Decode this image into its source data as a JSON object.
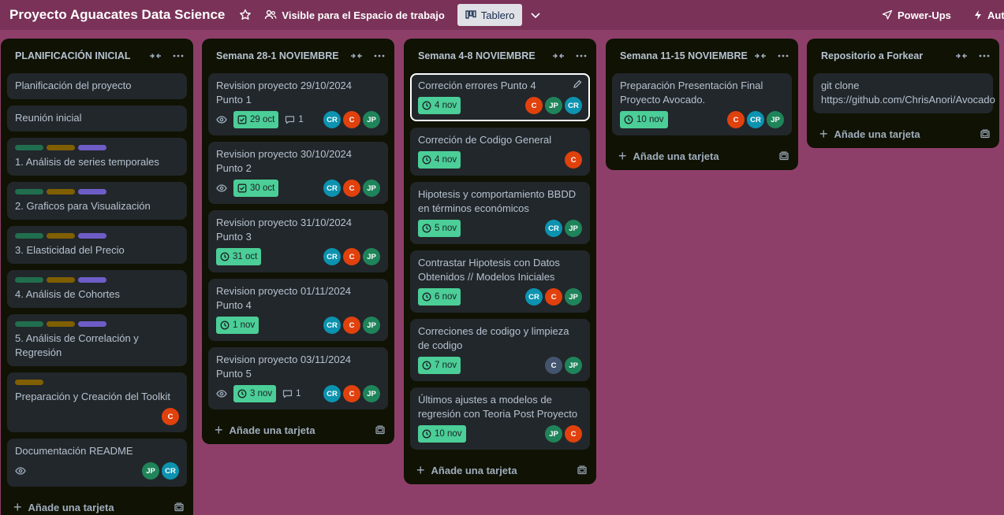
{
  "header": {
    "board_title": "Proyecto Aguacates Data Science",
    "visibility_label": "Visible para el Espacio de trabajo",
    "view_label": "Tablero",
    "powerups_label": "Power-Ups",
    "automation_label": "Aut"
  },
  "colors": {
    "background": "#8e3f69",
    "list_bg": "#101204",
    "card_bg": "#22272b",
    "date_badge": "#4bce97",
    "label_green": "#216e4e",
    "label_yellow": "#7f5f01",
    "label_purple": "#6e5dc6",
    "avatar_cr": "#0c93b0",
    "avatar_c": "#e0410d",
    "avatar_jp": "#1f845a"
  },
  "add_card_label": "Añade una tarjeta",
  "lists": [
    {
      "title": "PLANIFICACIÓN INICIAL",
      "cards": [
        {
          "title": "Planificación del proyecto"
        },
        {
          "title": "Reunión inicial"
        },
        {
          "title": "1. Análisis de series temporales",
          "labels": [
            "green",
            "yellow",
            "purple"
          ]
        },
        {
          "title": "2. Graficos para Visualización",
          "labels": [
            "green",
            "yellow",
            "purple"
          ]
        },
        {
          "title": "3. Elasticidad del Precio",
          "labels": [
            "green",
            "yellow",
            "purple"
          ]
        },
        {
          "title": "4. Análisis de Cohortes",
          "labels": [
            "green",
            "yellow",
            "purple"
          ]
        },
        {
          "title": "5. Análisis de Correlación y Regresión",
          "labels": [
            "green",
            "yellow",
            "purple"
          ]
        },
        {
          "title": "Preparación y Creación del Toolkit",
          "labels": [
            "yellow"
          ],
          "members": [
            "C"
          ]
        },
        {
          "title": "Documentación README",
          "watch": true,
          "members": [
            "JP",
            "CR"
          ]
        }
      ]
    },
    {
      "title": "Semana 28-1 NOVIEMBRE",
      "cards": [
        {
          "title": "Revision proyecto 29/10/2024 Punto 1",
          "watch": true,
          "date": "29 oct",
          "date_icon": "check",
          "comments": "1",
          "members": [
            "CR",
            "C",
            "JP"
          ]
        },
        {
          "title": "Revision proyecto 30/10/2024 Punto 2",
          "watch": true,
          "date": "30 oct",
          "date_icon": "check",
          "members": [
            "CR",
            "C",
            "JP"
          ]
        },
        {
          "title": "Revision proyecto 31/10/2024 Punto 3",
          "date": "31 oct",
          "date_icon": "clock",
          "members": [
            "CR",
            "C",
            "JP"
          ]
        },
        {
          "title": "Revision proyecto 01/11/2024 Punto 4",
          "date": "1 nov",
          "date_icon": "clock",
          "members": [
            "CR",
            "C",
            "JP"
          ]
        },
        {
          "title": "Revision proyecto 03/11/2024 Punto 5",
          "watch": true,
          "date": "3 nov",
          "date_icon": "clock",
          "comments": "1",
          "members": [
            "CR",
            "C",
            "JP"
          ]
        }
      ]
    },
    {
      "title": "Semana 4-8 NOVIEMBRE",
      "cards": [
        {
          "title": "Correción errores Punto 4",
          "date": "4 nov",
          "date_icon": "clock",
          "members": [
            "C",
            "JP",
            "CR"
          ],
          "active": true
        },
        {
          "title": "Correción de Codigo General",
          "date": "4 nov",
          "date_icon": "clock",
          "members": [
            "C"
          ]
        },
        {
          "title": "Hipotesis y comportamiento BBDD en términos económicos",
          "date": "5 nov",
          "date_icon": "clock",
          "members": [
            "CR",
            "JP"
          ]
        },
        {
          "title": "Contrastar Hipotesis con Datos Obtenidos // Modelos Iniciales",
          "date": "6 nov",
          "date_icon": "clock",
          "members": [
            "CR",
            "C",
            "JP"
          ]
        },
        {
          "title": "Correciones de codigo y limpieza de codigo",
          "date": "7 nov",
          "date_icon": "clock",
          "members": [
            "C2",
            "JP"
          ]
        },
        {
          "title": "Últimos ajustes a modelos de regresión con Teoria Post Proyecto",
          "date": "10 nov",
          "date_icon": "clock",
          "members": [
            "JP",
            "C"
          ]
        }
      ]
    },
    {
      "title": "Semana 11-15 NOVIEMBRE",
      "cards": [
        {
          "title": "Preparación Presentación Final Proyecto Avocado.",
          "date": "10 nov",
          "date_icon": "clock",
          "members": [
            "C",
            "CR",
            "JP"
          ]
        }
      ]
    },
    {
      "title": "Repositorio a Forkear",
      "cards": [
        {
          "title": "git clone https://github.com/ChrisAnori/Avocado"
        }
      ]
    }
  ]
}
